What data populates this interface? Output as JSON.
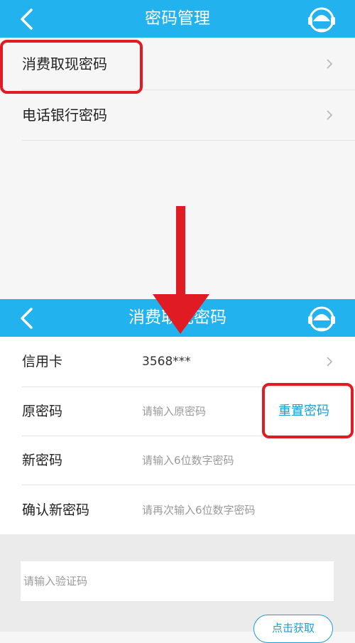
{
  "top_screen": {
    "title": "密码管理",
    "menu_items": [
      {
        "label": "消费取现密码"
      },
      {
        "label": "电话银行密码"
      }
    ]
  },
  "bottom_screen": {
    "title": "消费取现密码",
    "card": {
      "label": "信用卡",
      "value": "3568***"
    },
    "old_password": {
      "label": "原密码",
      "placeholder": "请输入原密码",
      "reset_label": "重置密码"
    },
    "new_password": {
      "label": "新密码",
      "placeholder": "请输入6位数字密码"
    },
    "confirm_password": {
      "label": "确认新密码",
      "placeholder": "请再次输入6位数字密码"
    },
    "verification": {
      "placeholder": "请输入验证码",
      "button_label": "点击获取"
    }
  },
  "colors": {
    "navbar": "#22b2ee",
    "accent": "#1a9fd6",
    "annotation_red": "#e01b24"
  },
  "icons": [
    "back-arrow-icon",
    "customer-service-icon",
    "chevron-right-icon",
    "down-arrow-annotation"
  ]
}
